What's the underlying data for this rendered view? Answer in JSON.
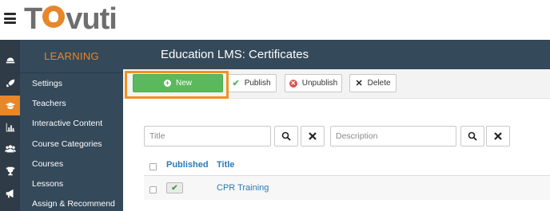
{
  "logo": {
    "text_before": "T",
    "text_after": "vuti"
  },
  "icons": {
    "menu": "hamburger-menu-icon",
    "rail": [
      "hard-hat-icon",
      "rocket-icon",
      "graduation-cap-icon",
      "bar-chart-icon",
      "users-icon",
      "trophy-icon",
      "megaphone-icon"
    ]
  },
  "sidebar": {
    "header": "LEARNING",
    "items": [
      {
        "label": "Settings"
      },
      {
        "label": "Teachers"
      },
      {
        "label": "Interactive Content"
      },
      {
        "label": "Course Categories"
      },
      {
        "label": "Courses"
      },
      {
        "label": "Lessons"
      },
      {
        "label": "Assign & Recommend"
      }
    ]
  },
  "page": {
    "title": "Education LMS: Certificates"
  },
  "toolbar": {
    "new_label": "New",
    "publish_label": "Publish",
    "unpublish_label": "Unpublish",
    "delete_label": "Delete"
  },
  "filters": {
    "title_placeholder": "Title",
    "description_placeholder": "Description"
  },
  "table": {
    "headers": {
      "published": "Published",
      "title": "Title"
    },
    "rows": [
      {
        "published": true,
        "title": "CPR Training"
      }
    ]
  },
  "colors": {
    "accent": "#e8862a",
    "sidebar_bg": "#34495a",
    "new_button": "#5cb85c",
    "link": "#2a7ab8",
    "highlight": "#f4901e"
  }
}
